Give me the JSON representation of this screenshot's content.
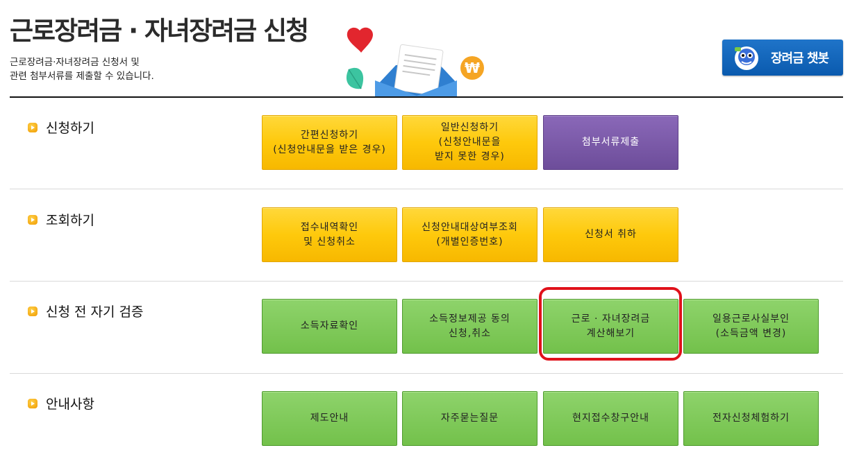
{
  "header": {
    "title": "근로장려금 · 자녀장려금 신청",
    "subtitle": "근로장려금·자녀장려금 신청서 및\n관련 첨부서류를 제출할 수 있습니다."
  },
  "chatbot": {
    "label": "장려금 챗봇",
    "icon": "robot-mascot-icon"
  },
  "sections": [
    {
      "label": "신청하기",
      "buttons": [
        {
          "label": "간편신청하기\n(신청안내문을 받은 경우)",
          "color": "yellow"
        },
        {
          "label": "일반신청하기\n(신청안내문을\n받지 못한 경우)",
          "color": "yellow"
        },
        {
          "label": "첨부서류제출",
          "color": "purple"
        }
      ]
    },
    {
      "label": "조회하기",
      "buttons": [
        {
          "label": "접수내역확인\n및 신청취소",
          "color": "yellow"
        },
        {
          "label": "신청안내대상여부조회\n(개별인증번호)",
          "color": "yellow"
        },
        {
          "label": "신청서 취하",
          "color": "yellow"
        }
      ]
    },
    {
      "label": "신청 전 자기 검증",
      "buttons": [
        {
          "label": "소득자료확인",
          "color": "green"
        },
        {
          "label": "소득정보제공 동의\n신청,취소",
          "color": "green"
        },
        {
          "label": "근로 · 자녀장려금\n계산해보기",
          "color": "green",
          "highlighted": true
        },
        {
          "label": "일용근로사실부인\n(소득금액 변경)",
          "color": "green"
        }
      ]
    },
    {
      "label": "안내사항",
      "buttons": [
        {
          "label": "제도안내",
          "color": "green"
        },
        {
          "label": "자주묻는질문",
          "color": "green"
        },
        {
          "label": "현지접수창구안내",
          "color": "green"
        },
        {
          "label": "전자신청체험하기",
          "color": "green"
        }
      ]
    }
  ],
  "colors": {
    "yellow": "#fec90c",
    "purple": "#7a5aa8",
    "green": "#7cc653",
    "highlight": "#e0111a",
    "chatbot": "#1466bb"
  }
}
